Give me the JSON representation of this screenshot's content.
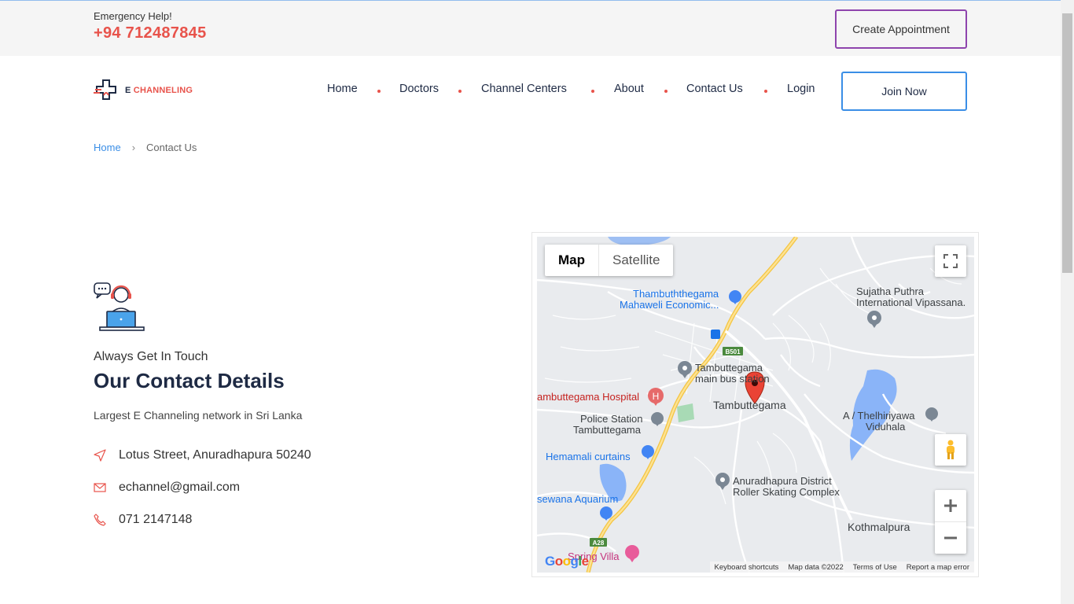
{
  "topbar": {
    "emergency_label": "Emergency Help!",
    "emergency_phone": "+94 712487845",
    "appointment_button": "Create Appointment"
  },
  "brand": {
    "logo_text_prefix": "E",
    "logo_text": " CHANNELING",
    "accent": "#e8534b",
    "navy": "#1e2a44"
  },
  "nav": {
    "items": [
      "Home",
      "Doctors",
      "Channel Centers",
      "About",
      "Contact Us",
      "Login"
    ],
    "join_button": "Join Now"
  },
  "breadcrumb": {
    "home": "Home",
    "separator": "›",
    "current": "Contact Us"
  },
  "contact": {
    "tagline": "Always Get In Touch",
    "heading": "Our Contact Details",
    "subtitle": "Largest E Channeling network in Sri Lanka",
    "address": "Lotus Street, Anuradhapura 50240",
    "email": "echannel@gmail.com",
    "phone": "071 2147148"
  },
  "map": {
    "toggle_map": "Map",
    "toggle_satellite": "Satellite",
    "labels": {
      "mahaweli_1": "Thambuththegama",
      "mahaweli_2": "Mahaweli Economic...",
      "vipassana_1": "Sujatha Puthra",
      "vipassana_2": "International Vipassana.",
      "busstation_1": "Tambuttegama",
      "busstation_2": "main bus station",
      "hospital": "ambuttegama Hospital",
      "town": "Tambuttegama",
      "police_1": "Police Station",
      "police_2": "Tambuttegama",
      "thelhiriyawa_1": "A / Thelhiriyawa",
      "thelhiriyawa_2": "Viduhala",
      "curtains": "Hemamali curtains",
      "skating_1": "Anuradhapura District",
      "skating_2": "Roller Skating Complex",
      "aquarium": "sewana Aquarium",
      "kothmalpura": "Kothmalpura",
      "spring_villa": "Spring Villa",
      "road_b501": "B501",
      "road_a28": "A28"
    },
    "footer": {
      "shortcuts": "Keyboard shortcuts",
      "map_data": "Map data ©2022",
      "terms": "Terms of Use",
      "report": "Report a map error"
    },
    "google_logo": "Google"
  }
}
